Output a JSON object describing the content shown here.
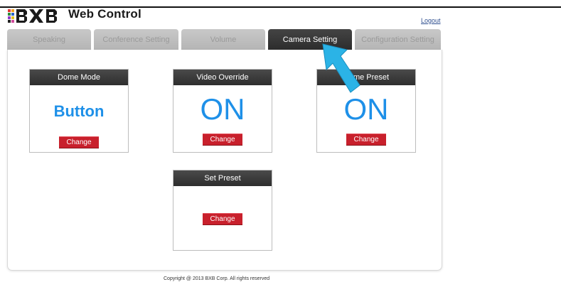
{
  "header": {
    "logo_text": "BXB",
    "title": "Web Control",
    "logout": "Logout"
  },
  "tabs": [
    {
      "label": "Speaking",
      "active": false
    },
    {
      "label": "Conference Setting",
      "active": false
    },
    {
      "label": "Volume",
      "active": false
    },
    {
      "label": "Camera Setting",
      "active": true
    },
    {
      "label": "Configuration Setting",
      "active": false
    }
  ],
  "cards": {
    "dome_mode": {
      "title": "Dome Mode",
      "value": "Button",
      "button": "Change"
    },
    "video_override": {
      "title": "Video Override",
      "value": "ON",
      "button": "Change"
    },
    "home_preset": {
      "title": "Home Preset",
      "value": "ON",
      "button": "Change"
    },
    "set_preset": {
      "title": "Set Preset",
      "button": "Change"
    }
  },
  "footer": "Copyright @ 2013 BXB Corp. All rights reserved",
  "colors": {
    "accent_blue": "#1e90e8",
    "change_red": "#c8202c",
    "active_tab": "#333333",
    "pointer_arrow": "#2bb3e6"
  }
}
